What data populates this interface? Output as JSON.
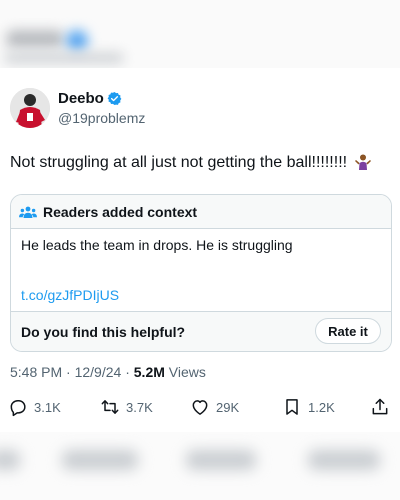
{
  "author": {
    "name": "Deebo",
    "handle": "@19problemz",
    "verified": true
  },
  "tweet": {
    "text": "Not struggling at all just not getting the ball!!!!!!!!",
    "emoji": "person-shrugging-emoji"
  },
  "context": {
    "title": "Readers added context",
    "body": "He leads the team in drops. He is struggling",
    "link": "t.co/gzJfPDIjUS",
    "question": "Do you find this helpful?",
    "rate_label": "Rate it"
  },
  "meta": {
    "time": "5:48 PM",
    "date": "12/9/24",
    "views_count": "5.2M",
    "views_label": "Views"
  },
  "actions": {
    "replies": "3.1K",
    "retweets": "3.7K",
    "likes": "29K",
    "bookmarks": "1.2K"
  },
  "colors": {
    "accent": "#1d9bf0",
    "text": "#0f1419",
    "muted": "#536471",
    "border": "#cfd9de",
    "panel": "#f7f9f9"
  }
}
